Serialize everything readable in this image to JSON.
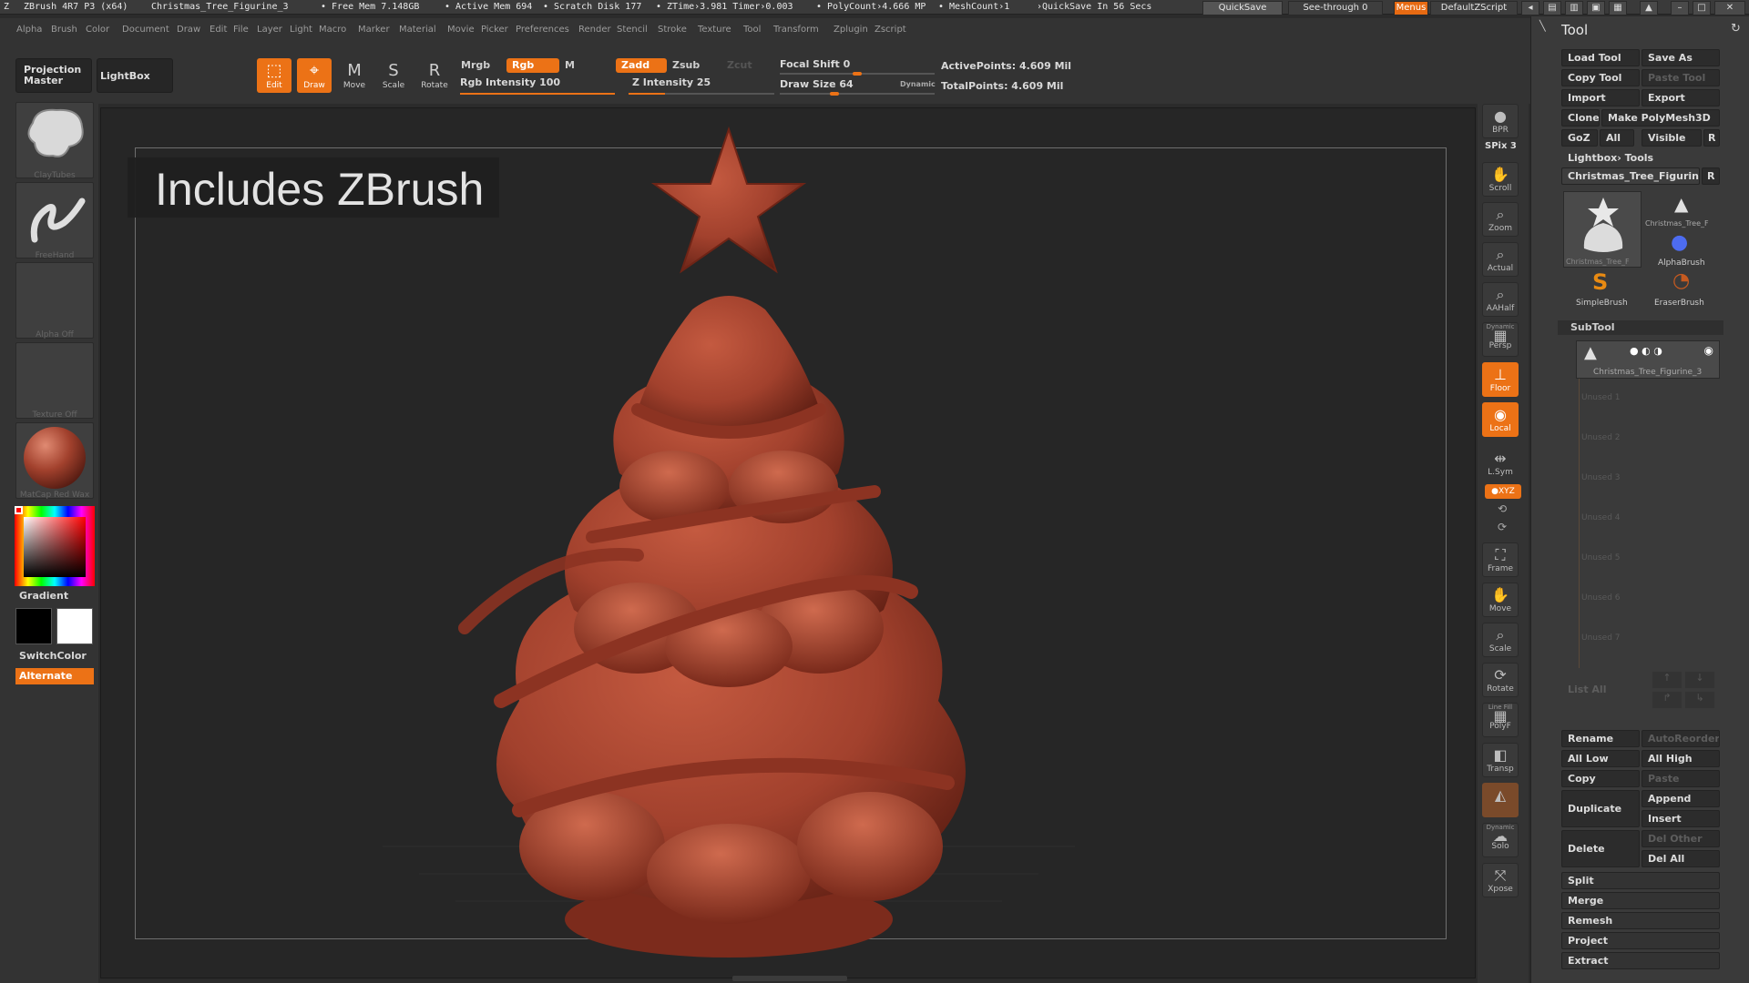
{
  "colors": {
    "accent": "#ec7216",
    "model": "#a2412d",
    "background": "#262626"
  },
  "titlebar": {
    "app": "ZBrush 4R7 P3 (x64)",
    "document": "Christmas_Tree_Figurine_3",
    "free_mem": "• Free Mem 7.148GB",
    "active_mem": "• Active Mem 694",
    "scratch": "• Scratch Disk 177",
    "ztime": "• ZTime›3.981 Timer›0.003",
    "polycount": "• PolyCount›4.666 MP",
    "meshcount": "• MeshCount›1",
    "quicksave_info": "›QuickSave In 56 Secs",
    "quicksave_btn": "QuickSave",
    "seethrough": "See-through  0",
    "menus": "Menus",
    "script": "DefaultZScript"
  },
  "menubar": {
    "items": [
      "Alpha",
      "Brush",
      "Color",
      "Document",
      "Draw",
      "Edit",
      "File",
      "Layer",
      "Light",
      "Macro",
      "Marker",
      "Material",
      "Movie",
      "Picker",
      "Preferences",
      "Render",
      "Stencil",
      "Stroke",
      "Texture",
      "Tool",
      "Transform",
      "Zplugin",
      "Zscript"
    ]
  },
  "topshelf": {
    "projection_master": "Projection Master",
    "lightbox": "LightBox",
    "edit": "Edit",
    "draw": "Draw",
    "move": "Move",
    "scale": "Scale",
    "rotate": "Rotate",
    "mrgb": "Mrgb",
    "rgb": "Rgb",
    "m": "M",
    "zadd": "Zadd",
    "zsub": "Zsub",
    "zcut": "Zcut",
    "rgb_intensity": "Rgb  Intensity 100",
    "z_intensity": "Z  Intensity 25",
    "focal_shift": "Focal  Shift 0",
    "draw_size": "Draw  Size 64",
    "dynamic": "Dynamic",
    "active_points": "ActivePoints: 4.609  Mil",
    "total_points": "TotalPoints: 4.609  Mil",
    "rgb_intensity_value": 1.0,
    "z_intensity_value": 0.25,
    "focal_shift_value": 0.5,
    "draw_size_value": 0.35
  },
  "leftshelf": {
    "brush": "ClayTubes",
    "stroke": "FreeHand",
    "alpha": "Alpha  Off",
    "texture": "Texture  Off",
    "material": "MatCap  Red  Wax",
    "gradient": "Gradient",
    "switchcolor": "SwitchColor",
    "alternate": "Alternate"
  },
  "banner": {
    "text": "Includes ZBrush"
  },
  "rightshelf": {
    "bpr": "BPR",
    "spix": "SPix 3",
    "scroll": "Scroll",
    "zoom": "Zoom",
    "actual": "Actual",
    "aahalf": "AAHalf",
    "dynamic_persp_top": "Dynamic",
    "persp": "Persp",
    "floor": "Floor",
    "local": "Local",
    "lsym": "L.Sym",
    "xyz": "●XYZ",
    "frame": "Frame",
    "move": "Move",
    "scale": "Scale",
    "rotate": "Rotate",
    "linefill": "Line Fill",
    "polyf": "PolyF",
    "transp": "Transp",
    "dynamic_solo": "Dynamic",
    "solo": "Solo",
    "xpose": "Xpose"
  },
  "tool": {
    "title": "Tool",
    "load_tool": "Load Tool",
    "save_as": "Save As",
    "copy_tool": "Copy Tool",
    "paste_tool": "Paste Tool",
    "import": "Import",
    "export": "Export",
    "clone": "Clone",
    "make_polymesh": "Make PolyMesh3D",
    "goz": "GoZ",
    "all": "All",
    "visible": "Visible",
    "r": "R",
    "lightbox_tools": "Lightbox› Tools",
    "current_tool": "Christmas_Tree_Figurine",
    "thumbs": [
      {
        "label": "Christmas_Tree_F"
      },
      {
        "label": "Christmas_Tree_F"
      },
      {
        "label": "AlphaBrush"
      },
      {
        "label": "SimpleBrush"
      },
      {
        "label": "EraserBrush"
      }
    ],
    "subtool": {
      "header": "SubTool",
      "active": "Christmas_Tree_Figurine_3",
      "unused": [
        "Unused 1",
        "Unused 2",
        "Unused 3",
        "Unused 4",
        "Unused 5",
        "Unused 6",
        "Unused 7"
      ],
      "list_all": "List All"
    },
    "rename": "Rename",
    "autoreorder": "AutoReorder",
    "all_low": "All Low",
    "all_high": "All High",
    "copy": "Copy",
    "paste": "Paste",
    "duplicate": "Duplicate",
    "append": "Append",
    "insert": "Insert",
    "delete": "Delete",
    "del_other": "Del Other",
    "del_all": "Del All",
    "split": "Split",
    "merge": "Merge",
    "remesh": "Remesh",
    "project": "Project",
    "extract": "Extract"
  }
}
